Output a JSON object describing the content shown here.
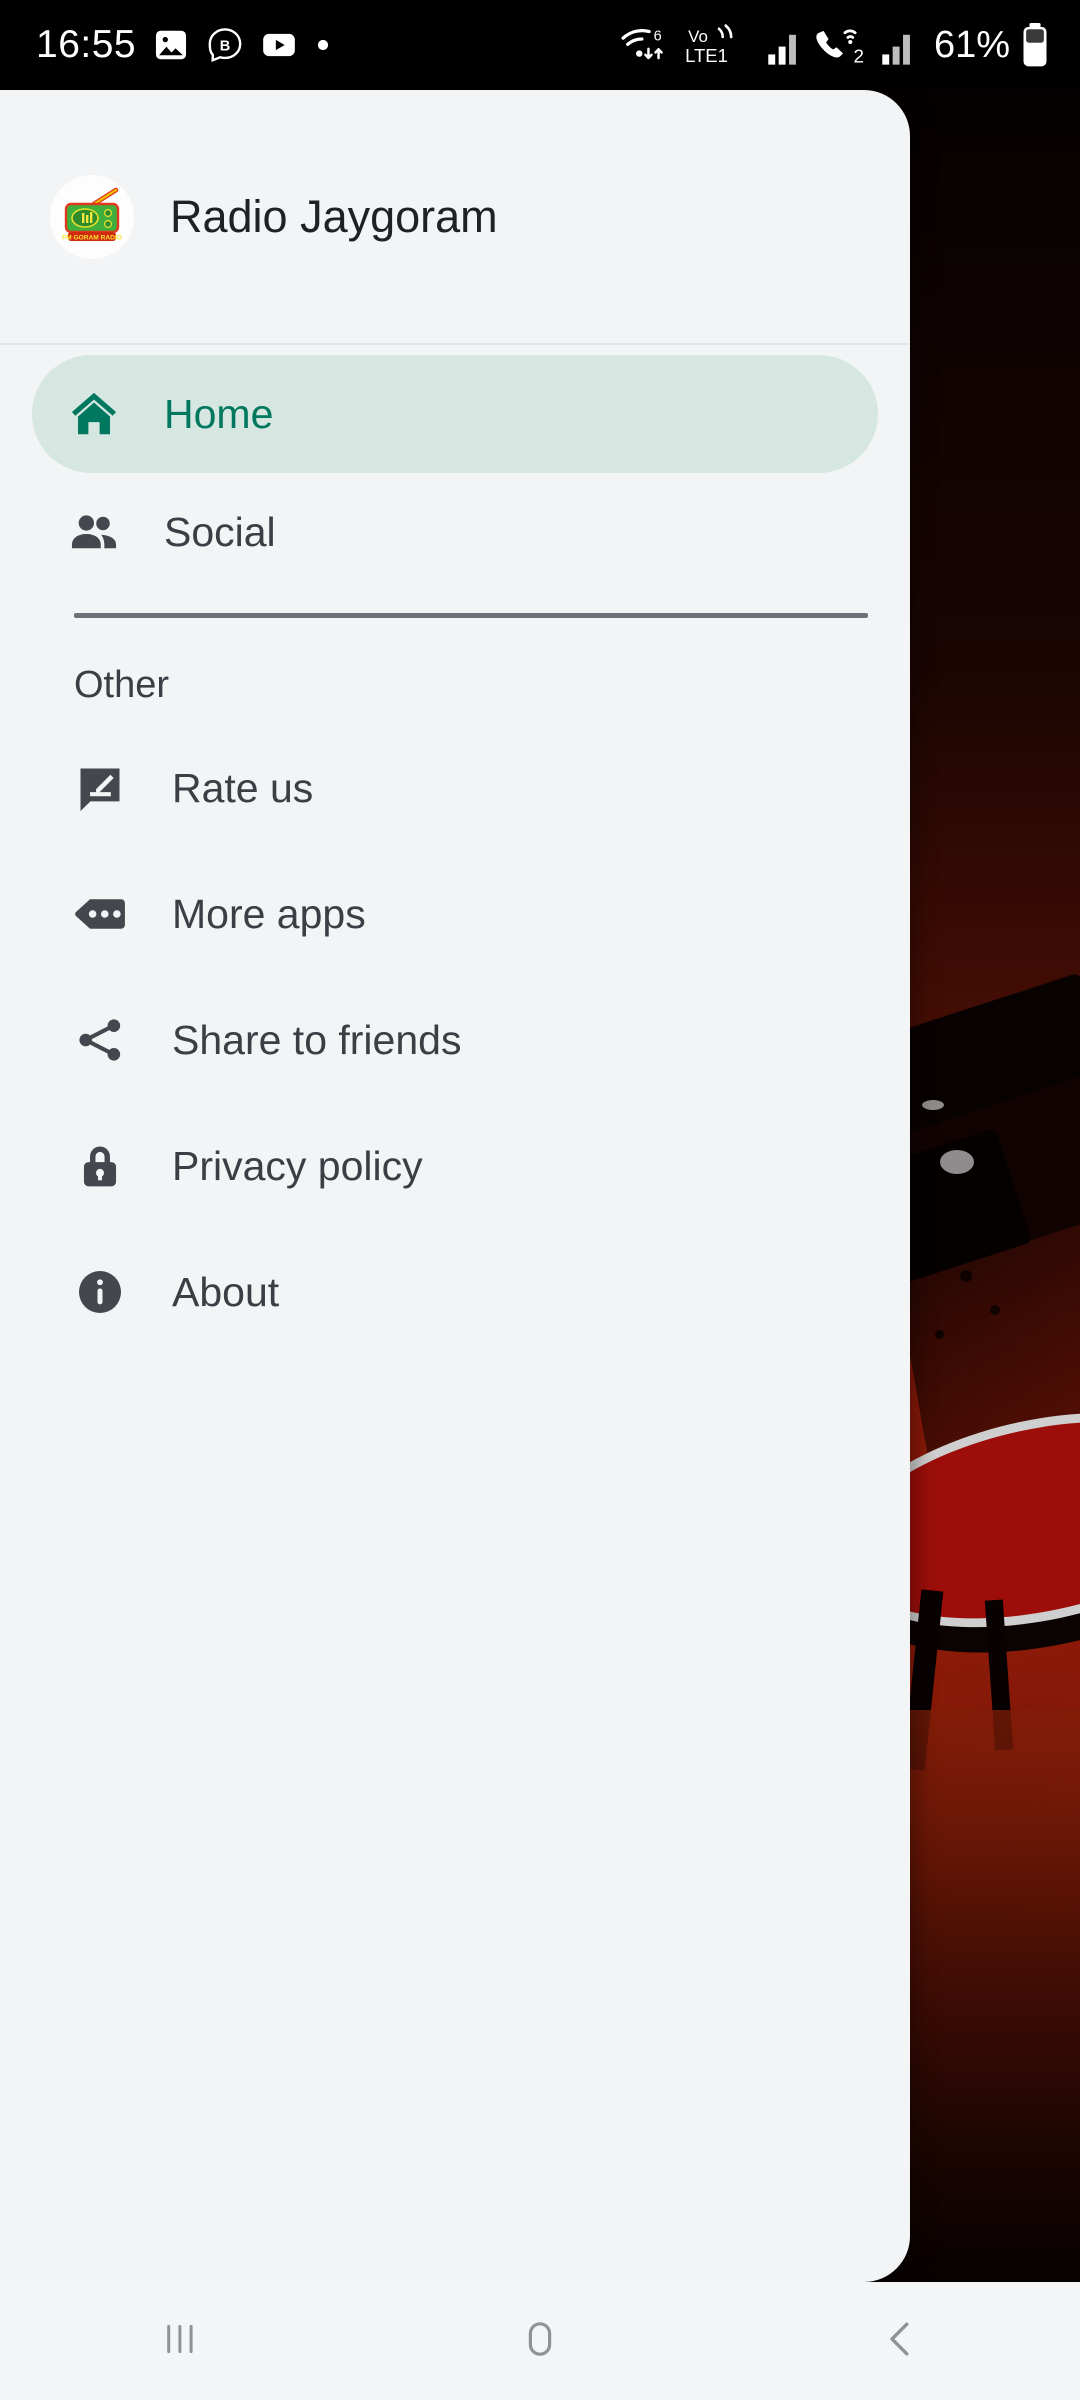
{
  "status_bar": {
    "time": "16:55",
    "battery_percent": "61%",
    "left_icons": [
      "gallery-icon",
      "b-messenger-icon",
      "youtube-icon",
      "more-notifications-dot"
    ],
    "right_icons": [
      "wifi-6-icon",
      "volte-lte1-icon",
      "signal-bars-1-icon",
      "wifi-calling-2-icon",
      "signal-bars-2-icon",
      "battery-icon"
    ],
    "network_labels": {
      "wifi_gen": "6",
      "volte": "Vo",
      "lte": "LTE1",
      "sim2": "2"
    }
  },
  "drawer": {
    "header": {
      "title": "Radio Jaygoram",
      "logo_name": "radio-jaygoram-logo",
      "logo_text": "FM GORAM RADIO"
    },
    "main_items": [
      {
        "label": "Home",
        "icon": "home-icon",
        "active": true
      },
      {
        "label": "Social",
        "icon": "people-icon",
        "active": false
      }
    ],
    "section_label": "Other",
    "other_items": [
      {
        "label": "Rate us",
        "icon": "rate-review-icon"
      },
      {
        "label": "More apps",
        "icon": "more-apps-tag-icon"
      },
      {
        "label": "Share to friends",
        "icon": "share-icon"
      },
      {
        "label": "Privacy policy",
        "icon": "lock-icon"
      },
      {
        "label": "About",
        "icon": "info-icon"
      }
    ]
  },
  "system_nav": {
    "buttons": [
      {
        "name": "recents-button",
        "icon": "recents-bars-icon"
      },
      {
        "name": "home-button",
        "icon": "home-pill-icon"
      },
      {
        "name": "back-button",
        "icon": "back-chevron-icon"
      }
    ]
  },
  "colors": {
    "accent": "#00785f",
    "active_pill_bg": "#d6e7e1",
    "drawer_bg": "#f2f4f6",
    "icon_gray": "#44474d",
    "text": "#3b3e44",
    "status_bar_bg": "#000000",
    "backdrop_red": "#82200a"
  }
}
